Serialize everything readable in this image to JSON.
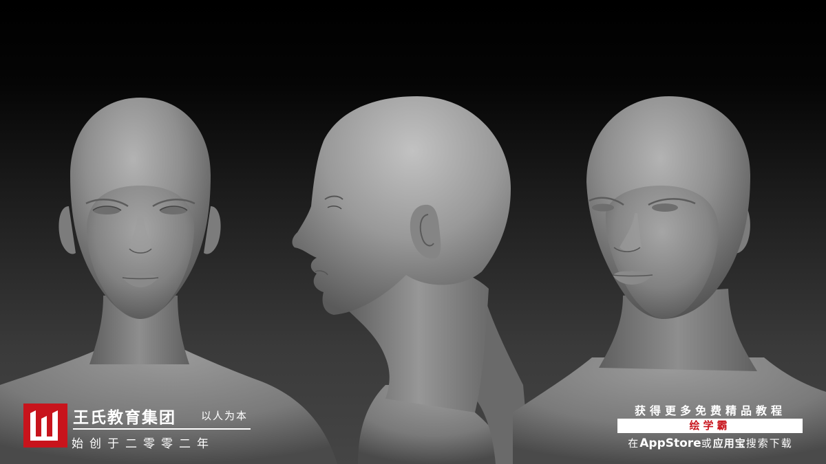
{
  "brand": {
    "name": "王氏教育集团",
    "slogan": "以人为本",
    "founded": "始创于二零零二年"
  },
  "promo": {
    "headline": "获得更多免费精品教程",
    "app_name": "绘学霸",
    "search_prefix": "在",
    "store_a": "AppStore",
    "connector": "或",
    "store_b": "应用宝",
    "search_suffix": "搜索下载"
  },
  "colors": {
    "brand_red": "#c8141c",
    "text": "#ffffff"
  }
}
